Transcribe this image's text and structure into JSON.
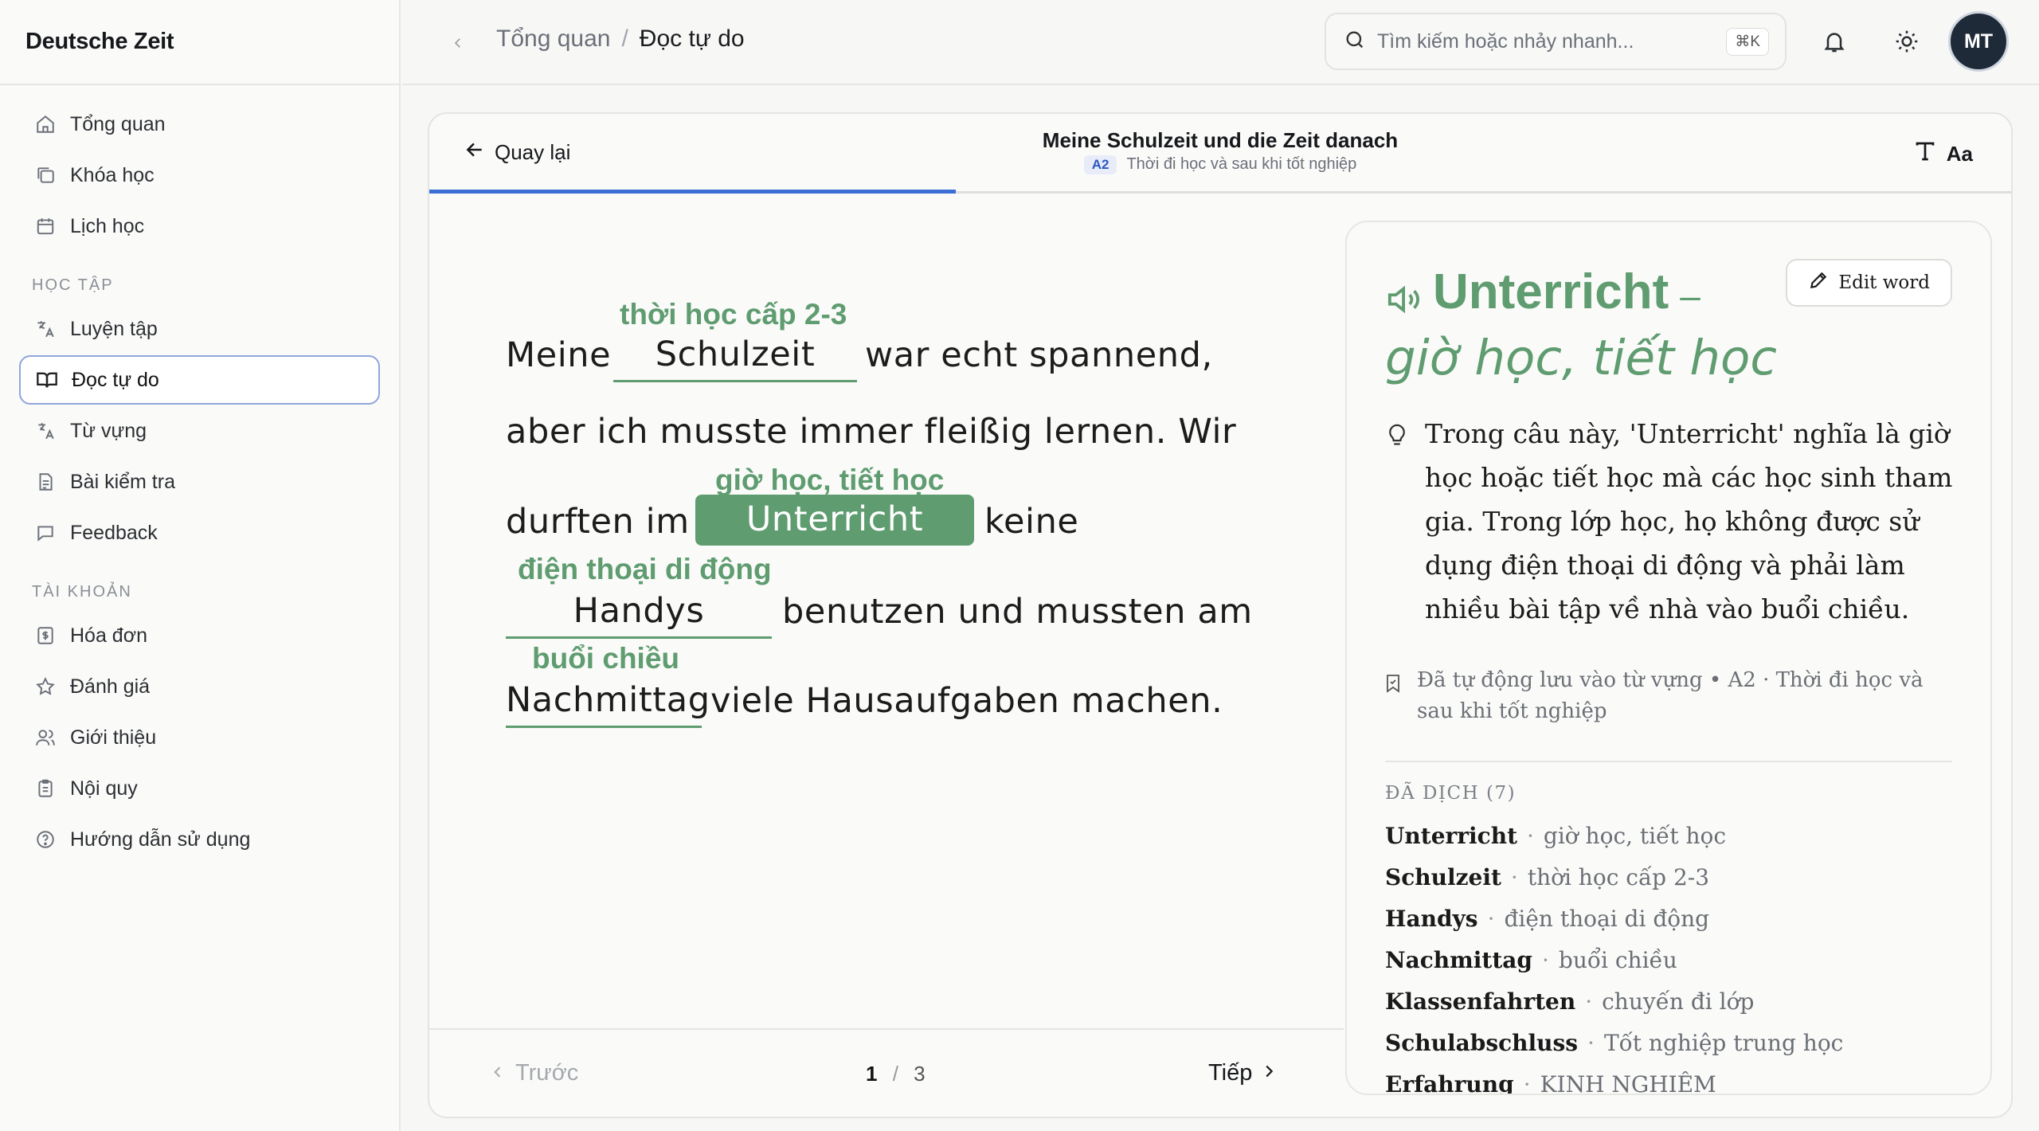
{
  "app": {
    "brand": "Deutsche Zeit"
  },
  "sidebar": {
    "main_items": [
      {
        "label": "Tổng quan",
        "icon": "home-icon"
      },
      {
        "label": "Khóa học",
        "icon": "courses-icon"
      },
      {
        "label": "Lịch học",
        "icon": "calendar-icon"
      }
    ],
    "section_learning": "HỌC TẬP",
    "learning_items": [
      {
        "label": "Luyện tập",
        "icon": "translate-practice-icon"
      },
      {
        "label": "Đọc tự do",
        "icon": "book-open-icon",
        "active": true
      },
      {
        "label": "Từ vựng",
        "icon": "vocabulary-icon"
      },
      {
        "label": "Bài kiểm tra",
        "icon": "test-document-icon"
      },
      {
        "label": "Feedback",
        "icon": "message-icon"
      }
    ],
    "section_account": "TÀI KHOẢN",
    "account_items": [
      {
        "label": "Hóa đơn",
        "icon": "invoice-icon"
      },
      {
        "label": "Đánh giá",
        "icon": "star-icon"
      },
      {
        "label": "Giới thiệu",
        "icon": "users-icon"
      },
      {
        "label": "Nội quy",
        "icon": "rules-clipboard-icon"
      },
      {
        "label": "Hướng dẫn sử dụng",
        "icon": "help-circle-icon"
      }
    ]
  },
  "header": {
    "breadcrumb_parent": "Tổng quan",
    "breadcrumb_separator": "/",
    "breadcrumb_current": "Đọc tự do",
    "search_placeholder": "Tìm kiếm hoặc nhảy nhanh...",
    "search_shortcut": "⌘K",
    "avatar_initials": "MT"
  },
  "reader": {
    "back_label": "Quay lại",
    "title": "Meine Schulzeit und die Zeit danach",
    "level": "A2",
    "subtitle": "Thời đi học và sau khi tốt nghiệp",
    "font_toggle_label": "Aa",
    "progress": 0.333,
    "text": {
      "l1_before": "Meine",
      "w_schulzeit": "Schulzeit",
      "g_schulzeit": "thời học cấp 2-3",
      "l1_after": "war echt spannend,",
      "l2": "aber ich musste immer fleißig lernen. Wir",
      "l3_before": "durften im",
      "w_unterricht": "Unterricht",
      "g_unterricht": "giờ học, tiết học",
      "l3_after": "keine",
      "w_handys": "Handys",
      "g_handys": "điện thoại di động",
      "l4_after": "benutzen und mussten am",
      "w_nachmittag": "Nachmittag",
      "g_nachmittag": "buổi chiều",
      "l5_after": "viele Hausaufgaben machen."
    },
    "pager": {
      "prev_label": "Trước",
      "current_page": "1",
      "separator": "/",
      "total_pages": "3",
      "next_label": "Tiếp"
    }
  },
  "word_panel": {
    "edit_label": "Edit word",
    "word": "Unterricht",
    "dash": "–",
    "meaning": "giờ học, tiết học",
    "explanation": "Trong câu này, 'Unterricht' nghĩa là giờ học hoặc tiết học mà các học sinh tham gia. Trong lớp học, họ không được sử dụng điện thoại di động và phải làm nhiều bài tập về nhà vào buổi chiều.",
    "saved_note": "Đã tự động lưu vào từ vựng • A2 · Thời đi học và sau khi tốt nghiệp",
    "translated_heading": "ĐÃ DỊCH (7)",
    "translations": [
      {
        "de": "Unterricht",
        "vi": "giờ học, tiết học"
      },
      {
        "de": "Schulzeit",
        "vi": "thời học cấp 2-3"
      },
      {
        "de": "Handys",
        "vi": "điện thoại di động"
      },
      {
        "de": "Nachmittag",
        "vi": "buổi chiều"
      },
      {
        "de": "Klassenfahrten",
        "vi": "chuyến đi lớp"
      },
      {
        "de": "Schulabschluss",
        "vi": "Tốt nghiệp trung học"
      },
      {
        "de": "Erfahrung",
        "vi": "KINH NGHIỆM"
      }
    ]
  },
  "colors": {
    "accent_green": "#5f9c70",
    "progress_blue": "#3c6fd6",
    "active_border": "#8fa6dc"
  }
}
